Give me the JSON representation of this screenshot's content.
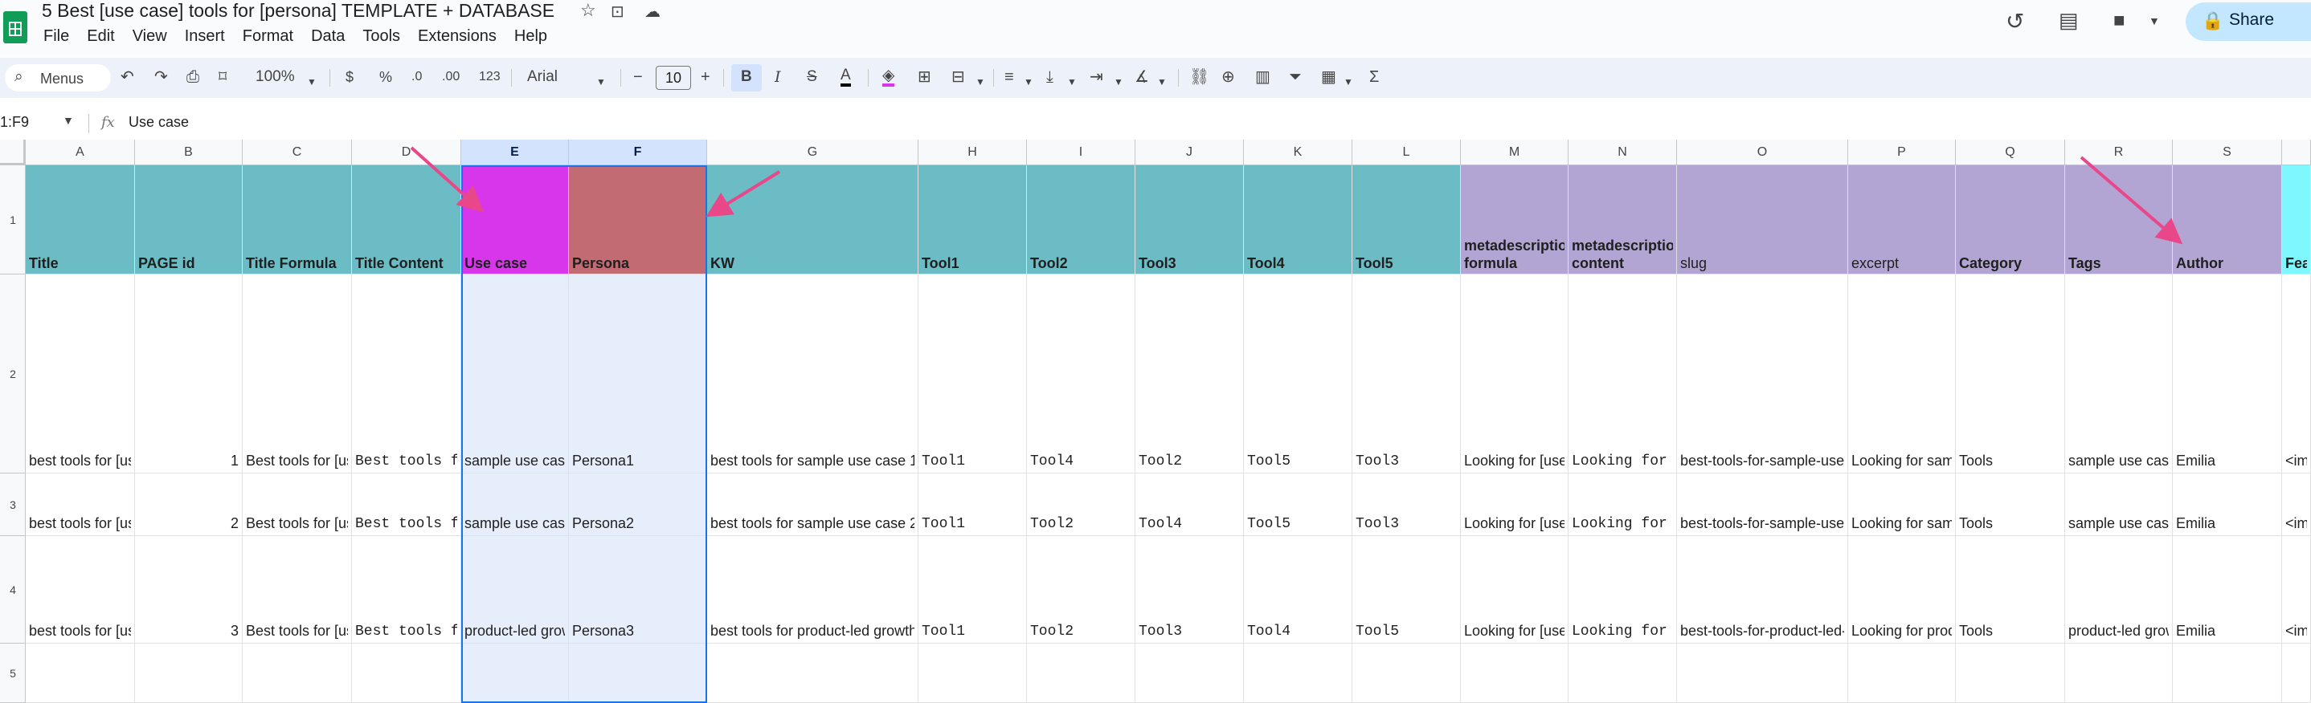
{
  "app": {
    "title": "5 Best [use case] tools for [persona] TEMPLATE + DATABASE",
    "menu": [
      "File",
      "Edit",
      "View",
      "Insert",
      "Format",
      "Data",
      "Tools",
      "Extensions",
      "Help"
    ],
    "share_label": "Share"
  },
  "toolbar": {
    "menus_label": "Menus",
    "zoom": "100%",
    "currency": "$",
    "percent": "%",
    "dec_decrease": ".0",
    "dec_increase": ".00",
    "number_format": "123",
    "font": "Arial",
    "font_size": "10",
    "minus": "−",
    "plus": "+",
    "bold": "B",
    "italic": "I",
    "strike": "S",
    "text_color": "A",
    "sum": "Σ"
  },
  "formula_bar": {
    "name_box": "1:F9",
    "fx": "fx",
    "content": "Use case"
  },
  "colors": {
    "teal": "#6bbcc4",
    "magenta": "#d736eb",
    "rose": "#c26b72",
    "lavender": "#b3a5d3",
    "cyan": "#7ff7ff",
    "arrow": "#e8488a"
  },
  "columns": [
    "A",
    "B",
    "C",
    "D",
    "E",
    "F",
    "G",
    "H",
    "I",
    "J",
    "K",
    "L",
    "M",
    "N",
    "O",
    "P",
    "Q",
    "R",
    "S"
  ],
  "rows": [
    "1",
    "2",
    "3",
    "4",
    "5"
  ],
  "header_row": [
    "Title",
    "PAGE id",
    "Title Formula",
    "Title Content",
    "Use case",
    "Persona",
    "KW",
    "Tool1",
    "Tool2",
    "Tool3",
    "Tool4",
    "Tool5",
    "metadescription formula",
    "metadescription content",
    "slug",
    "excerpt",
    "Category",
    "Tags",
    "Author",
    "Feat"
  ],
  "data_rows": [
    [
      "best tools for [use",
      "1",
      "Best tools for [us",
      "Best tools fo",
      "sample use case",
      "Persona1",
      "best tools for sample use case 1",
      "Tool1",
      "Tool4",
      "Tool2",
      "Tool5",
      "Tool3",
      "Looking for [use",
      "Looking for sa",
      "best-tools-for-sample-use-",
      "Looking for samp",
      "Tools",
      "sample use case",
      "Emilia",
      "<img"
    ],
    [
      "best tools for [use",
      "2",
      "Best tools for [us",
      "Best tools fo",
      "sample use case",
      "Persona2",
      "best tools for sample use case 2",
      "Tool1",
      "Tool2",
      "Tool4",
      "Tool5",
      "Tool3",
      "Looking for [use",
      "Looking for sa",
      "best-tools-for-sample-use-",
      "Looking for samp",
      "Tools",
      "sample use case",
      "Emilia",
      "<img"
    ],
    [
      "best tools for [use",
      "3",
      "Best tools for [us",
      "Best tools fo",
      "product-led grow",
      "Persona3",
      "best tools for product-led growth",
      "Tool1",
      "Tool2",
      "Tool3",
      "Tool4",
      "Tool5",
      "Looking for [use",
      "Looking for pr",
      "best-tools-for-product-led-",
      "Looking for prod",
      "Tools",
      "product-led grow",
      "Emilia",
      "<img"
    ]
  ]
}
